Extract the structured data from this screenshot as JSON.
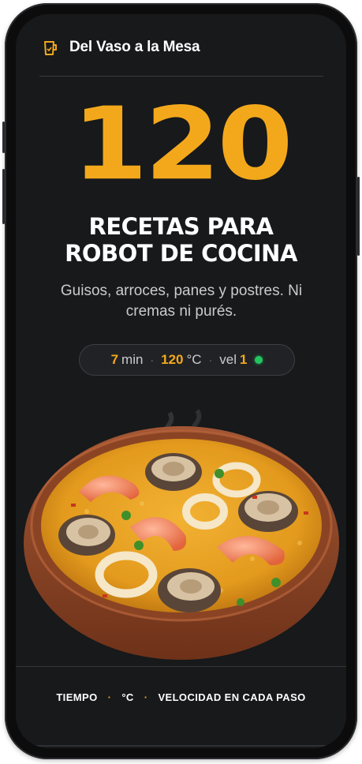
{
  "header": {
    "brand_name": "Del Vaso a la Mesa",
    "brand_icon": "jug-icon"
  },
  "hero": {
    "big_number": "120",
    "headline_line1": "RECETAS PARA",
    "headline_line2": "ROBOT DE COCINA",
    "subtitle": "Guisos, arroces, panes y postres. Ni cremas ni purés."
  },
  "settings_pill": {
    "time_value": "7",
    "time_unit": "min",
    "temp_value": "120",
    "temp_unit": "°C",
    "speed_label": "vel",
    "speed_value": "1",
    "status_icon": "green-dot-icon"
  },
  "image": {
    "subject": "paella-dish-image"
  },
  "footer": {
    "item1": "TIEMPO",
    "item2": "°C",
    "item3": "VELOCIDAD EN CADA PASO",
    "separator": "·"
  },
  "colors": {
    "accent": "#f3a81c",
    "background": "#17191b",
    "status_green": "#22c55e",
    "text_muted": "#c9cbce"
  }
}
